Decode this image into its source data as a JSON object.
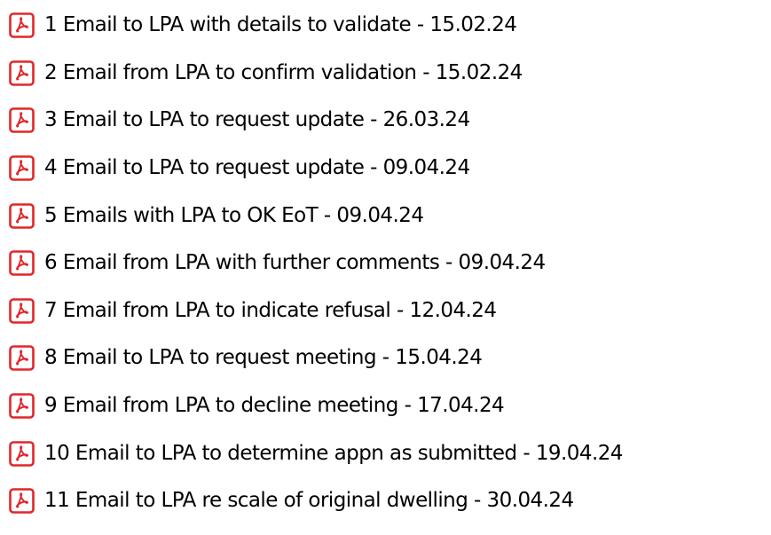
{
  "file_list": {
    "icon": "pdf-file-icon",
    "icon_color": "#e0272b",
    "items": [
      {
        "name": "1 Email to LPA with details to validate - 15.02.24"
      },
      {
        "name": "2 Email from LPA to confirm validation - 15.02.24"
      },
      {
        "name": "3 Email to LPA to request update - 26.03.24"
      },
      {
        "name": "4 Email to LPA to request update - 09.04.24"
      },
      {
        "name": "5 Emails with LPA to OK EoT - 09.04.24"
      },
      {
        "name": "6 Email from LPA with further comments - 09.04.24"
      },
      {
        "name": "7 Email from LPA to indicate refusal - 12.04.24"
      },
      {
        "name": "8 Email to LPA to request meeting - 15.04.24"
      },
      {
        "name": "9 Email from LPA to decline meeting - 17.04.24"
      },
      {
        "name": "10 Email to LPA to determine appn as submitted - 19.04.24"
      },
      {
        "name": "11 Email to LPA re scale of original dwelling - 30.04.24"
      }
    ]
  }
}
